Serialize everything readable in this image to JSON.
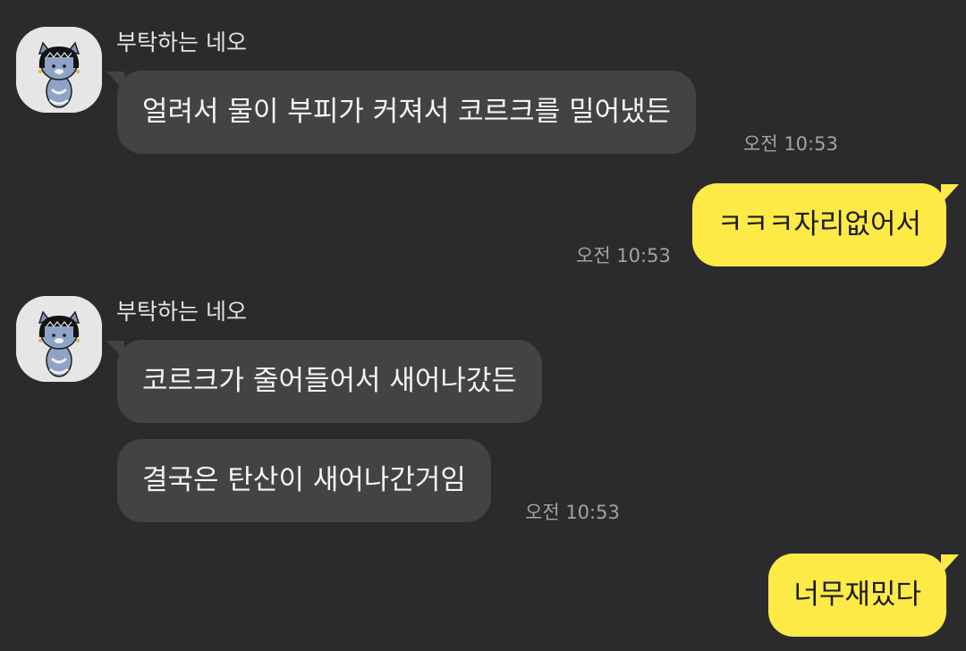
{
  "sender_name": "부탁하는 네오",
  "messages": [
    {
      "direction": "in",
      "text": "얼려서 물이 부피가 커져서 코르크를 밀어냈든",
      "time": "오전 10:53"
    },
    {
      "direction": "out",
      "text": "ㅋㅋㅋ자리없어서",
      "time": "오전 10:53"
    },
    {
      "direction": "in",
      "text": "코르크가 줄어들어서 새어나갔든",
      "time": ""
    },
    {
      "direction": "in",
      "text": "결국은 탄산이 새어나간거임",
      "time": "오전 10:53"
    },
    {
      "direction": "out",
      "text": "너무재밌다",
      "time": ""
    }
  ],
  "colors": {
    "background": "#2b2b2d",
    "incoming_bubble": "#434345",
    "outgoing_bubble": "#fdea47",
    "timestamp": "#a3a3a3"
  },
  "icons": {
    "avatar": "neo-cat-avatar-icon"
  }
}
